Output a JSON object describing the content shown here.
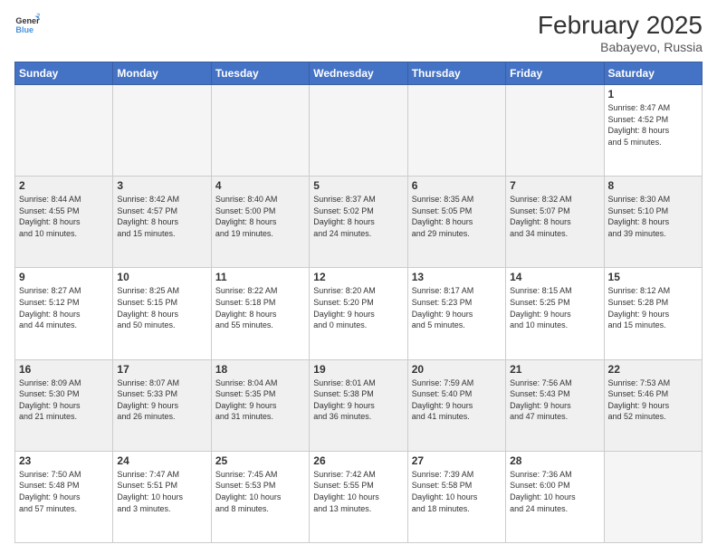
{
  "header": {
    "logo_general": "General",
    "logo_blue": "Blue",
    "month_year": "February 2025",
    "location": "Babayevo, Russia"
  },
  "days_of_week": [
    "Sunday",
    "Monday",
    "Tuesday",
    "Wednesday",
    "Thursday",
    "Friday",
    "Saturday"
  ],
  "weeks": [
    {
      "shaded": false,
      "days": [
        {
          "num": "",
          "info": ""
        },
        {
          "num": "",
          "info": ""
        },
        {
          "num": "",
          "info": ""
        },
        {
          "num": "",
          "info": ""
        },
        {
          "num": "",
          "info": ""
        },
        {
          "num": "",
          "info": ""
        },
        {
          "num": "1",
          "info": "Sunrise: 8:47 AM\nSunset: 4:52 PM\nDaylight: 8 hours\nand 5 minutes."
        }
      ]
    },
    {
      "shaded": true,
      "days": [
        {
          "num": "2",
          "info": "Sunrise: 8:44 AM\nSunset: 4:55 PM\nDaylight: 8 hours\nand 10 minutes."
        },
        {
          "num": "3",
          "info": "Sunrise: 8:42 AM\nSunset: 4:57 PM\nDaylight: 8 hours\nand 15 minutes."
        },
        {
          "num": "4",
          "info": "Sunrise: 8:40 AM\nSunset: 5:00 PM\nDaylight: 8 hours\nand 19 minutes."
        },
        {
          "num": "5",
          "info": "Sunrise: 8:37 AM\nSunset: 5:02 PM\nDaylight: 8 hours\nand 24 minutes."
        },
        {
          "num": "6",
          "info": "Sunrise: 8:35 AM\nSunset: 5:05 PM\nDaylight: 8 hours\nand 29 minutes."
        },
        {
          "num": "7",
          "info": "Sunrise: 8:32 AM\nSunset: 5:07 PM\nDaylight: 8 hours\nand 34 minutes."
        },
        {
          "num": "8",
          "info": "Sunrise: 8:30 AM\nSunset: 5:10 PM\nDaylight: 8 hours\nand 39 minutes."
        }
      ]
    },
    {
      "shaded": false,
      "days": [
        {
          "num": "9",
          "info": "Sunrise: 8:27 AM\nSunset: 5:12 PM\nDaylight: 8 hours\nand 44 minutes."
        },
        {
          "num": "10",
          "info": "Sunrise: 8:25 AM\nSunset: 5:15 PM\nDaylight: 8 hours\nand 50 minutes."
        },
        {
          "num": "11",
          "info": "Sunrise: 8:22 AM\nSunset: 5:18 PM\nDaylight: 8 hours\nand 55 minutes."
        },
        {
          "num": "12",
          "info": "Sunrise: 8:20 AM\nSunset: 5:20 PM\nDaylight: 9 hours\nand 0 minutes."
        },
        {
          "num": "13",
          "info": "Sunrise: 8:17 AM\nSunset: 5:23 PM\nDaylight: 9 hours\nand 5 minutes."
        },
        {
          "num": "14",
          "info": "Sunrise: 8:15 AM\nSunset: 5:25 PM\nDaylight: 9 hours\nand 10 minutes."
        },
        {
          "num": "15",
          "info": "Sunrise: 8:12 AM\nSunset: 5:28 PM\nDaylight: 9 hours\nand 15 minutes."
        }
      ]
    },
    {
      "shaded": true,
      "days": [
        {
          "num": "16",
          "info": "Sunrise: 8:09 AM\nSunset: 5:30 PM\nDaylight: 9 hours\nand 21 minutes."
        },
        {
          "num": "17",
          "info": "Sunrise: 8:07 AM\nSunset: 5:33 PM\nDaylight: 9 hours\nand 26 minutes."
        },
        {
          "num": "18",
          "info": "Sunrise: 8:04 AM\nSunset: 5:35 PM\nDaylight: 9 hours\nand 31 minutes."
        },
        {
          "num": "19",
          "info": "Sunrise: 8:01 AM\nSunset: 5:38 PM\nDaylight: 9 hours\nand 36 minutes."
        },
        {
          "num": "20",
          "info": "Sunrise: 7:59 AM\nSunset: 5:40 PM\nDaylight: 9 hours\nand 41 minutes."
        },
        {
          "num": "21",
          "info": "Sunrise: 7:56 AM\nSunset: 5:43 PM\nDaylight: 9 hours\nand 47 minutes."
        },
        {
          "num": "22",
          "info": "Sunrise: 7:53 AM\nSunset: 5:46 PM\nDaylight: 9 hours\nand 52 minutes."
        }
      ]
    },
    {
      "shaded": false,
      "days": [
        {
          "num": "23",
          "info": "Sunrise: 7:50 AM\nSunset: 5:48 PM\nDaylight: 9 hours\nand 57 minutes."
        },
        {
          "num": "24",
          "info": "Sunrise: 7:47 AM\nSunset: 5:51 PM\nDaylight: 10 hours\nand 3 minutes."
        },
        {
          "num": "25",
          "info": "Sunrise: 7:45 AM\nSunset: 5:53 PM\nDaylight: 10 hours\nand 8 minutes."
        },
        {
          "num": "26",
          "info": "Sunrise: 7:42 AM\nSunset: 5:55 PM\nDaylight: 10 hours\nand 13 minutes."
        },
        {
          "num": "27",
          "info": "Sunrise: 7:39 AM\nSunset: 5:58 PM\nDaylight: 10 hours\nand 18 minutes."
        },
        {
          "num": "28",
          "info": "Sunrise: 7:36 AM\nSunset: 6:00 PM\nDaylight: 10 hours\nand 24 minutes."
        },
        {
          "num": "",
          "info": ""
        }
      ]
    }
  ]
}
